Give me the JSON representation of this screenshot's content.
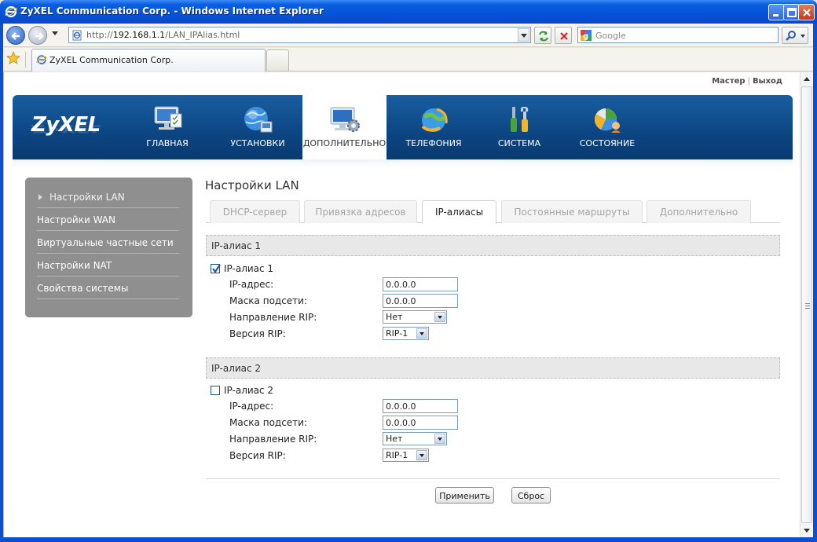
{
  "window": {
    "title": "ZyXEL Communication Corp. - Windows Internet Explorer"
  },
  "browser": {
    "url_prefix": "http://",
    "url_host": "192.168.1.1",
    "url_path": "/LAN_IPAlias.html",
    "search_placeholder": "Google",
    "tab_title": "ZyXEL Communication Corp."
  },
  "toplinks": {
    "wizard": "Мастер",
    "separator": "|",
    "logout": "Выход"
  },
  "header": {
    "logo": "ZyXEL",
    "nav": [
      {
        "label": "ГЛАВНАЯ",
        "icon": "monitor-icon"
      },
      {
        "label": "УСТАНОВКИ",
        "icon": "globe-icon"
      },
      {
        "label": "ДОПОЛНИТЕЛЬНО",
        "icon": "monitor-gear-icon",
        "active": true
      },
      {
        "label": "ТЕЛЕФОНИЯ",
        "icon": "phone-globe-icon"
      },
      {
        "label": "СИСТЕМА",
        "icon": "tools-icon"
      },
      {
        "label": "СОСТОЯНИЕ",
        "icon": "pie-chart-icon"
      }
    ]
  },
  "sidebar": {
    "items": [
      {
        "label": "Настройки LAN",
        "active": true
      },
      {
        "label": "Настройки WAN"
      },
      {
        "label": "Виртуальные частные сети"
      },
      {
        "label": "Настройки NAT"
      },
      {
        "label": "Свойства системы"
      }
    ]
  },
  "main": {
    "title": "Настройки LAN",
    "tabs": [
      {
        "label": "DHCP-сервер"
      },
      {
        "label": "Привязка адресов"
      },
      {
        "label": "IP-алиасы",
        "active": true
      },
      {
        "label": "Постоянные маршруты"
      },
      {
        "label": "Дополнительно"
      }
    ],
    "alias1": {
      "section": "IP-алиас 1",
      "enable_label": "IP-алиас 1",
      "enabled": true,
      "ip_label": "IP-адрес:",
      "ip_value": "0.0.0.0",
      "mask_label": "Маска подсети:",
      "mask_value": "0.0.0.0",
      "rip_dir_label": "Направление RIP:",
      "rip_dir_value": "Нет",
      "rip_ver_label": "Версия RIP:",
      "rip_ver_value": "RIP-1"
    },
    "alias2": {
      "section": "IP-алиас 2",
      "enable_label": "IP-алиас 2",
      "enabled": false,
      "ip_label": "IP-адрес:",
      "ip_value": "0.0.0.0",
      "mask_label": "Маска подсети:",
      "mask_value": "0.0.0.0",
      "rip_dir_label": "Направление RIP:",
      "rip_dir_value": "Нет",
      "rip_ver_label": "Версия RIP:",
      "rip_ver_value": "RIP-1"
    },
    "apply_label": "Применить",
    "reset_label": "Сброс"
  },
  "colors": {
    "header_bg": "#0d4785",
    "sidebar_bg": "#8f8f8f",
    "section_bg": "#e8e8e8",
    "titlebar": "#0553d8"
  }
}
